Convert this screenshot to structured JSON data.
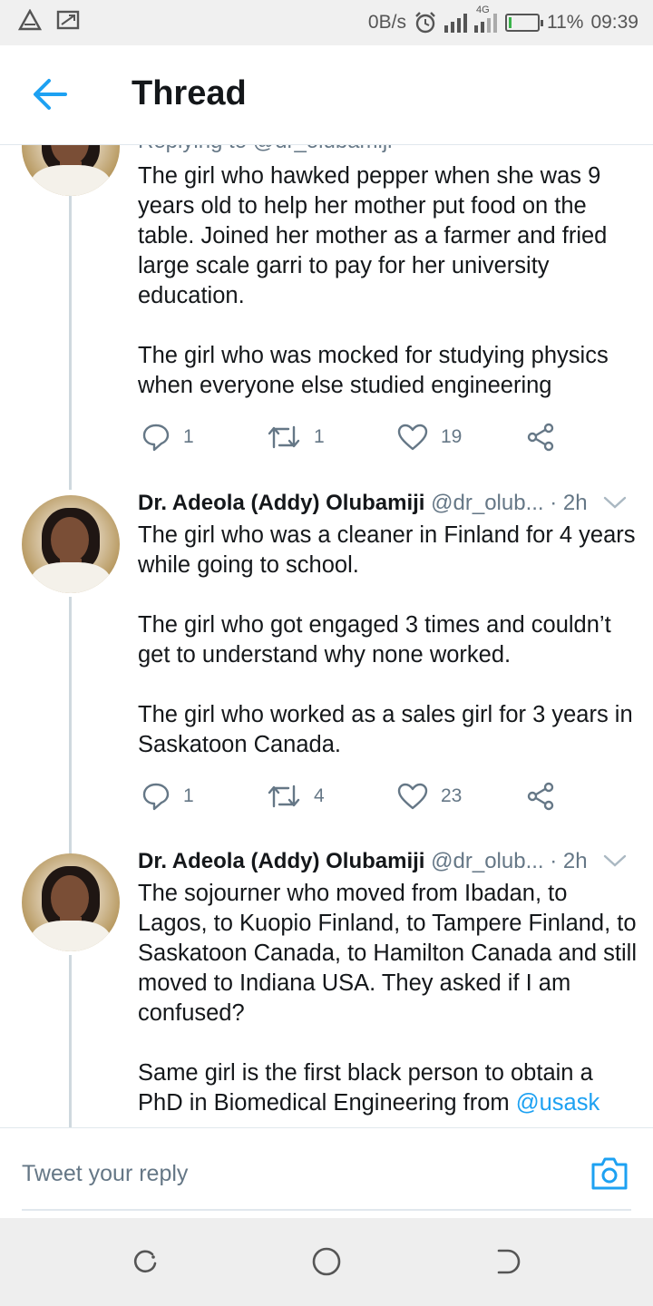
{
  "status_bar": {
    "speed": "0B/s",
    "network": "4G",
    "battery": "11%",
    "battery_level": 0.11,
    "time": "09:39"
  },
  "header": {
    "title": "Thread"
  },
  "tweets": [
    {
      "replying_to": "Replying to @dr_olubamiji",
      "paragraphs": [
        "The girl who hawked pepper when she was 9 years old to help her mother put food on the table. Joined her mother as a farmer and fried large scale garri to pay for her university education.",
        "The girl who was mocked for studying physics when everyone else studied engineering"
      ],
      "replies": "1",
      "retweets": "1",
      "likes": "19"
    },
    {
      "name": "Dr. Adeola (Addy) Olubamiji",
      "handle": "@dr_olub...",
      "time": "· 2h",
      "paragraphs": [
        "The girl who was a cleaner in Finland for 4 years while going to school.",
        "The girl who got engaged 3 times and couldn’t get to understand why none worked.",
        "The girl who worked as a sales girl for 3 years in Saskatoon Canada."
      ],
      "replies": "1",
      "retweets": "4",
      "likes": "23"
    },
    {
      "name": "Dr. Adeola (Addy) Olubamiji",
      "handle": "@dr_olub...",
      "time": "· 2h",
      "paragraphs": [
        "The sojourner who moved from Ibadan, to Lagos, to Kuopio Finland, to Tampere Finland, to Saskatoon Canada, to Hamilton Canada and still moved to Indiana USA. They asked if I am confused?"
      ],
      "last_paragraph_text": "Same girl is the first black person to obtain a PhD in Biomedical Engineering from ",
      "last_paragraph_mention": "@usask"
    }
  ],
  "reply_bar": {
    "placeholder": "Tweet your reply"
  },
  "colors": {
    "accent": "#1da1f2",
    "secondary_text": "#657786",
    "primary_text": "#14171a"
  },
  "icons": [
    "warning-icon",
    "screencast-icon",
    "alarm-icon",
    "signal-icon",
    "battery-icon",
    "back-arrow-icon",
    "avatar",
    "reply-icon",
    "retweet-icon",
    "like-icon",
    "share-icon",
    "chevron-down-icon",
    "camera-icon",
    "recent-apps-icon",
    "home-icon",
    "back-icon"
  ]
}
